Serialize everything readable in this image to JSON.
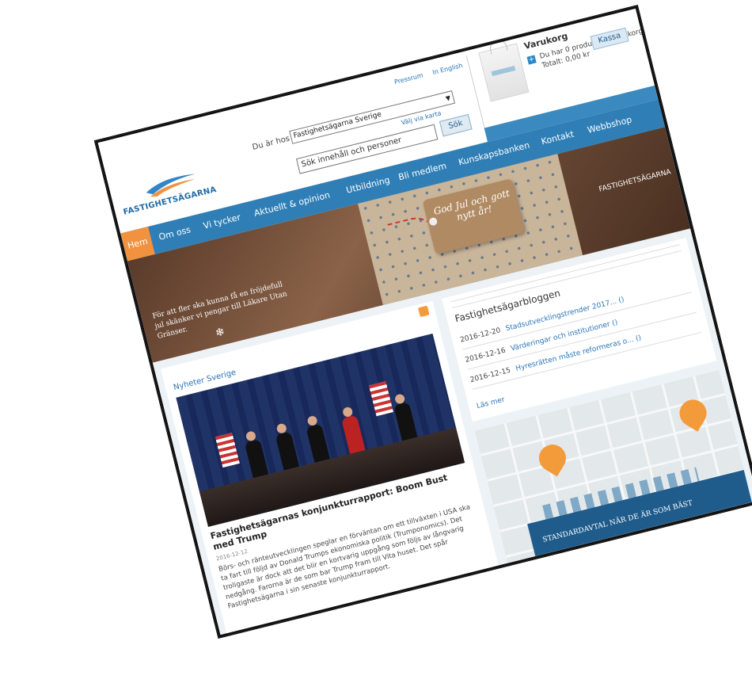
{
  "header": {
    "logo_text": "FASTIGHETSÄGARNA",
    "lang_links": [
      "Pressrum",
      "In English"
    ],
    "du_ar_hos_label": "Du är hos",
    "organization_select": "Fastighetsägarna Sverige",
    "valj_via_karta": "Välj via karta",
    "search_placeholder": "Sök innehåll och personer",
    "search_button": "Sök"
  },
  "cart": {
    "title": "Varukorg",
    "line1": "Du har 0 produkter i varukorgen.",
    "line2": "Totalt: 0,00 kr",
    "checkout_button": "Kassa"
  },
  "nav": {
    "items": [
      "Hem",
      "Om oss",
      "Vi tycker",
      "Aktuellt & opinion",
      "Utbildning",
      "Bli medlem",
      "Kunskapsbanken",
      "Kontakt",
      "Webbshop"
    ]
  },
  "banner": {
    "tag_text": "God Jul och gott nytt år!",
    "left_text": "För att fler ska kunna få en fröjdefull jul skänker vi pengar till Läkare Utan Gränser.",
    "logo_text": "FASTIGHETSÄGARNA"
  },
  "news": {
    "section_title": "Nyheter Sverige",
    "headline": "Fastighetsägarnas konjunkturrapport: Boom Bust med Trump",
    "date": "2016-12-12",
    "body": "Börs- och ränteutvecklingen speglar en förväntan om ett tillväxten i USA ska ta fart till följd av Donald Trumps ekonomiska politik (Trumponomics). Det troligaste är dock att det blir en kortvarig uppgång som följs av långvarig nedgång. Farorna är de som bar Trump fram till Vita huset. Det spår Fastighetsägarna i sin senaste konjunkturrapport."
  },
  "blog": {
    "title": "Fastighetsägarbloggen",
    "entries": [
      {
        "date": "2016-12-20",
        "link": "Stadsutvecklingstrender 2017...",
        "count": "()"
      },
      {
        "date": "2016-12-16",
        "link": "Värderingar och institutioner",
        "count": "()"
      },
      {
        "date": "2016-12-15",
        "link": "Hyresrätten måste reformeras o...",
        "count": "()"
      }
    ],
    "read_more": "Läs mer"
  },
  "promo": {
    "banner_text": "STANDARDAVTAL NÄR DE ÄR SOM BÄST"
  },
  "colors": {
    "nav_blue": "#2f7fb6",
    "accent_orange": "#f0923f",
    "link_blue": "#2a75b8"
  }
}
